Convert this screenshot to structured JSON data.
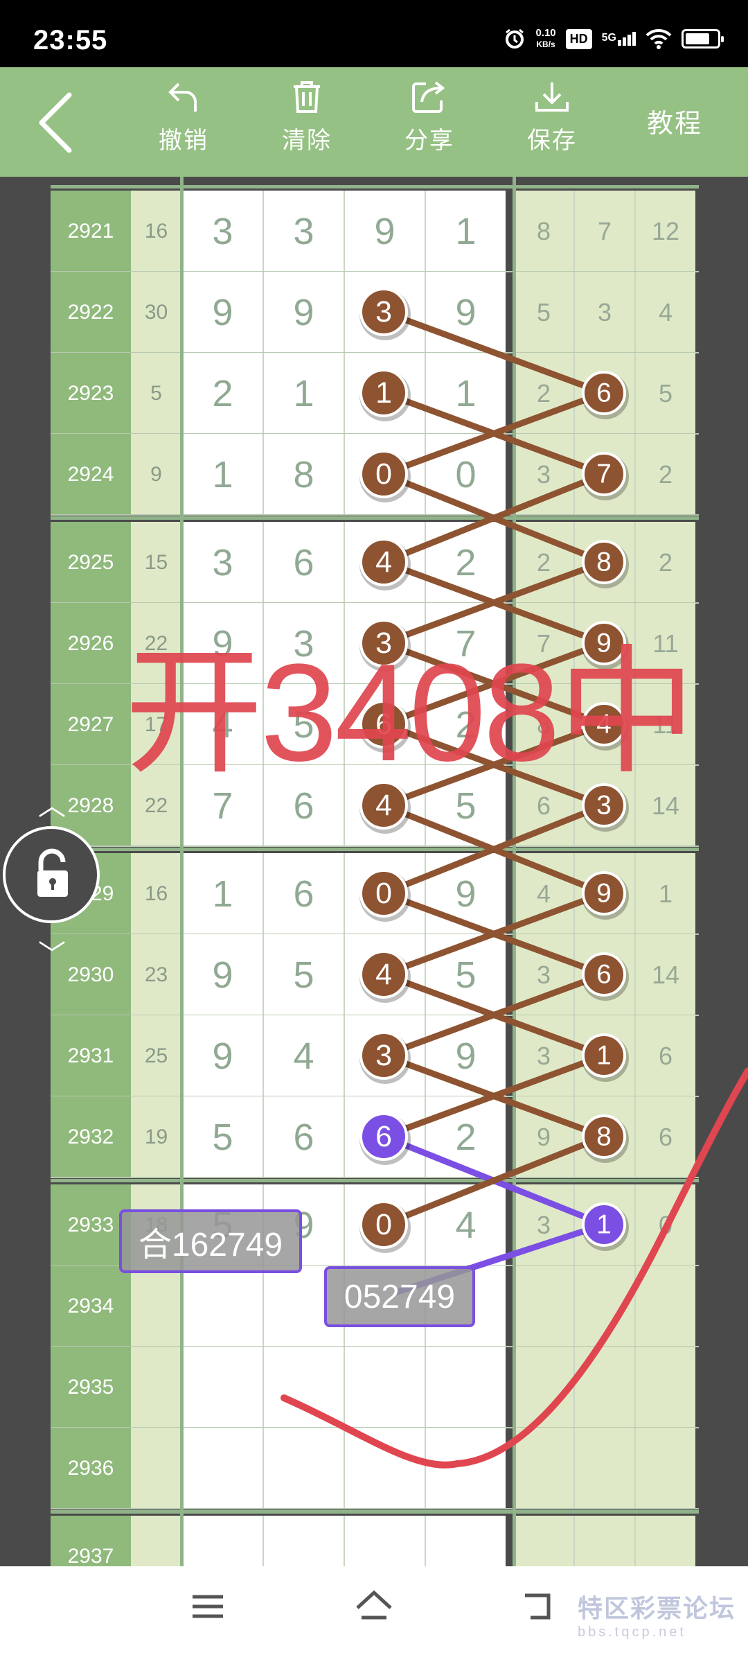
{
  "status": {
    "time": "23:55",
    "net_speed": "0.10",
    "net_unit": "KB/s",
    "hd": "HD",
    "signal": "5G"
  },
  "toolbar": {
    "undo_label": "撤销",
    "clear_label": "清除",
    "share_label": "分享",
    "save_label": "保存",
    "tutorial_label": "教程"
  },
  "rows": [
    {
      "id": "2921",
      "sum": "16",
      "d": [
        "3",
        "3",
        "9",
        "1"
      ],
      "r": [
        "8",
        "7",
        "12"
      ]
    },
    {
      "id": "2922",
      "sum": "30",
      "d": [
        "9",
        "9",
        "3",
        "9"
      ],
      "r": [
        "5",
        "3",
        "4"
      ]
    },
    {
      "id": "2923",
      "sum": "5",
      "d": [
        "2",
        "1",
        "1",
        "1"
      ],
      "r": [
        "2",
        "6",
        "5"
      ]
    },
    {
      "id": "2924",
      "sum": "9",
      "d": [
        "1",
        "8",
        "0",
        "0"
      ],
      "r": [
        "3",
        "7",
        "2"
      ]
    },
    {
      "id": "2925",
      "sum": "15",
      "d": [
        "3",
        "6",
        "4",
        "2"
      ],
      "r": [
        "2",
        "8",
        "2"
      ]
    },
    {
      "id": "2926",
      "sum": "22",
      "d": [
        "9",
        "3",
        "3",
        "7"
      ],
      "r": [
        "7",
        "9",
        "11"
      ]
    },
    {
      "id": "2927",
      "sum": "17",
      "d": [
        "4",
        "5",
        "6",
        "2"
      ],
      "r": [
        "8",
        "4",
        "11"
      ]
    },
    {
      "id": "2928",
      "sum": "22",
      "d": [
        "7",
        "6",
        "4",
        "5"
      ],
      "r": [
        "6",
        "3",
        "14"
      ]
    },
    {
      "id": "2929",
      "sum": "16",
      "d": [
        "1",
        "6",
        "0",
        "9"
      ],
      "r": [
        "4",
        "9",
        "1"
      ]
    },
    {
      "id": "2930",
      "sum": "23",
      "d": [
        "9",
        "5",
        "4",
        "5"
      ],
      "r": [
        "3",
        "6",
        "14"
      ]
    },
    {
      "id": "2931",
      "sum": "25",
      "d": [
        "9",
        "4",
        "3",
        "9"
      ],
      "r": [
        "3",
        "1",
        "6"
      ]
    },
    {
      "id": "2932",
      "sum": "19",
      "d": [
        "5",
        "6",
        "6",
        "2"
      ],
      "r": [
        "9",
        "8",
        "6"
      ]
    },
    {
      "id": "2933",
      "sum": "18",
      "d": [
        "5",
        "9",
        "0",
        "4"
      ],
      "r": [
        "3",
        "1",
        "0"
      ]
    },
    {
      "id": "2934",
      "sum": "",
      "d": [
        "",
        "",
        "",
        ""
      ],
      "r": [
        "",
        "",
        ""
      ]
    },
    {
      "id": "2935",
      "sum": "",
      "d": [
        "",
        "",
        "",
        ""
      ],
      "r": [
        "",
        "",
        ""
      ]
    },
    {
      "id": "2936",
      "sum": "",
      "d": [
        "",
        "",
        "",
        ""
      ],
      "r": [
        "",
        "",
        ""
      ]
    },
    {
      "id": "2937",
      "sum": "",
      "d": [
        "",
        "",
        "",
        ""
      ],
      "r": [
        "",
        "",
        ""
      ]
    }
  ],
  "markers": {
    "left": [
      "3",
      "1",
      "0",
      "4",
      "3",
      "6",
      "4",
      "0",
      "4",
      "3",
      "6",
      "0"
    ],
    "right": [
      "6",
      "7",
      "8",
      "9",
      "4",
      "3",
      "9",
      "6",
      "1",
      "8",
      "1"
    ]
  },
  "annotations": {
    "big_text": "开3408中",
    "badge_a": "合162749",
    "badge_b": "052749"
  },
  "watermark": {
    "text": "特区彩票论坛",
    "domain": "bbs.tqcp.net"
  },
  "colors": {
    "brown": "#8e5331",
    "purple": "#7b4fe3",
    "red": "#e0464f",
    "header_green": "#96c184"
  }
}
